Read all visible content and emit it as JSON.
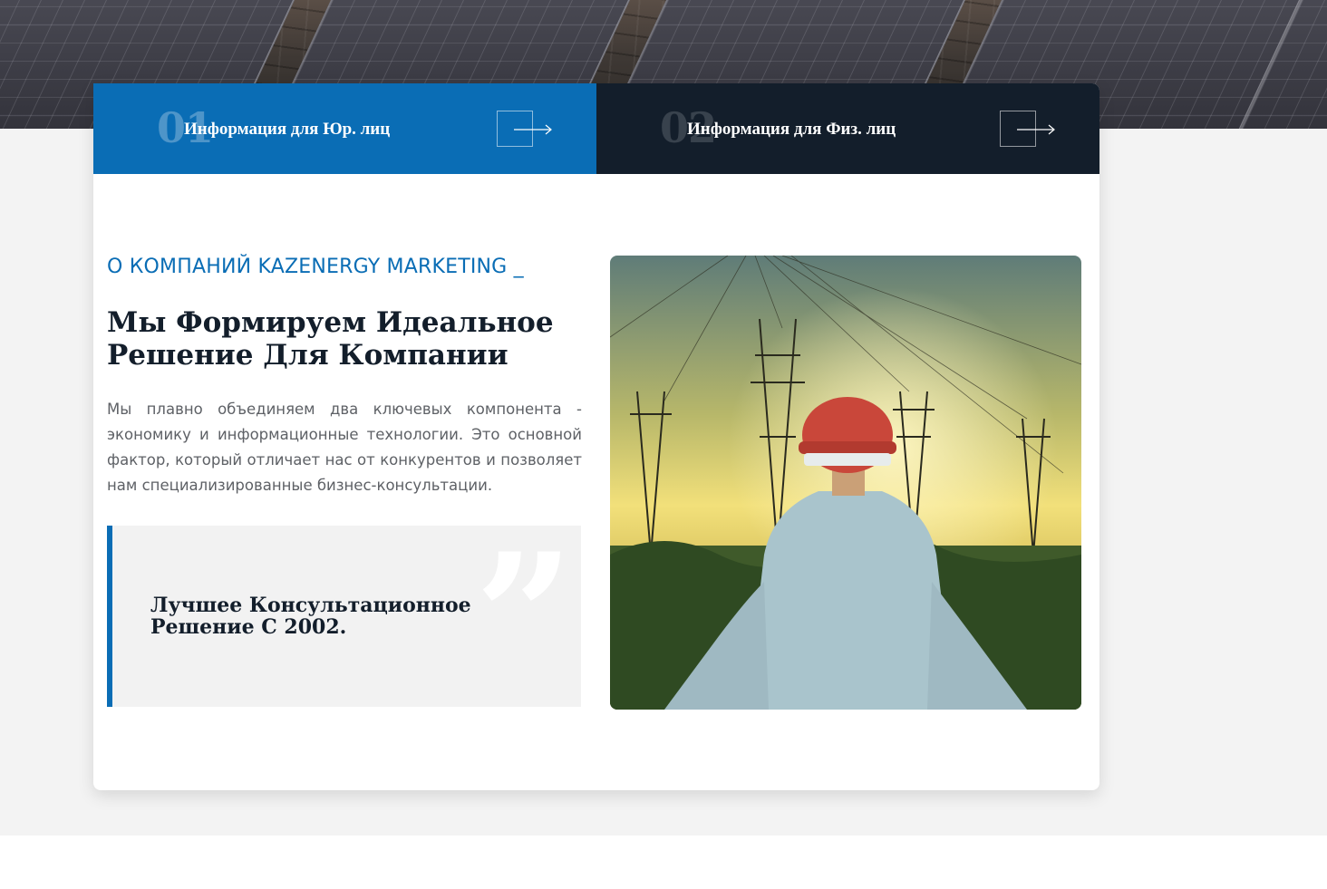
{
  "hero": {
    "image": "solar-panels"
  },
  "tabs": [
    {
      "number": "01",
      "label": "Информация для Юр. лиц",
      "accent": "#0a6db5",
      "arrow_icon": "arrow-right-icon"
    },
    {
      "number": "02",
      "label": "Информация для Физ. лиц",
      "accent": "#131e2b",
      "arrow_icon": "arrow-right-icon"
    }
  ],
  "about": {
    "subtitle": "О КОМПАНИЙ KAZENERGY MARKETING _",
    "headline": "Мы Формируем Идеальное Решение Для Компании",
    "paragraph": "Мы плавно объединяем два ключевых компонента - экономику и информационные технологии. Это основной фактор, который отличает нас от конкурентов и позволяет нам специализированные бизнес-консультации.",
    "quote": {
      "text": "Лучшее Консультационное Решение С 2002.",
      "mark_icon": "quote-icon"
    },
    "photo": {
      "image": "engineer-power-lines"
    }
  },
  "colors": {
    "brand_blue": "#0a6db5",
    "dark_navy": "#131e2b",
    "text_grey": "#5e6166",
    "band_grey": "#f3f3f3"
  }
}
